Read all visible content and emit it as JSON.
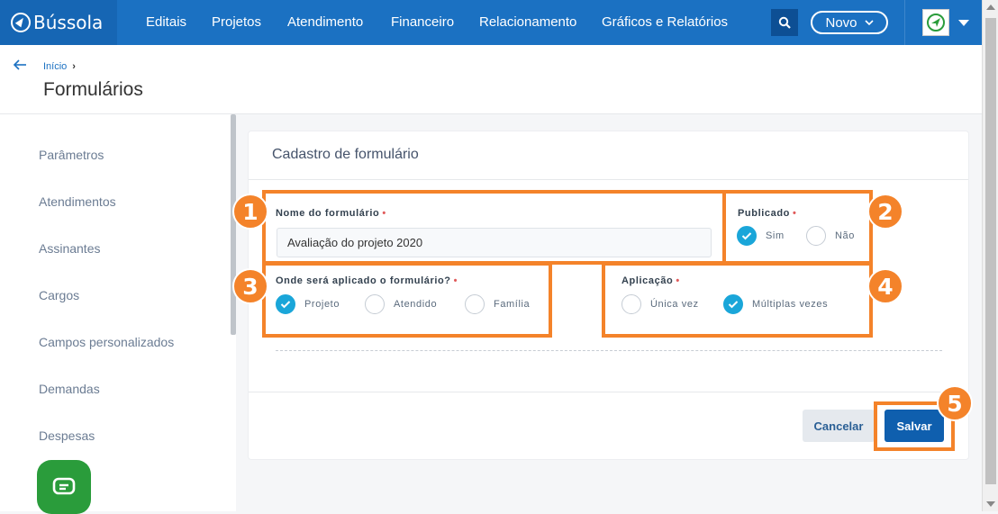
{
  "nav": {
    "brand": "Bússola",
    "items": [
      "Editais",
      "Projetos",
      "Atendimento",
      "Financeiro",
      "Relacionamento",
      "Gráficos e Relatórios"
    ],
    "novo_label": "Novo"
  },
  "header": {
    "breadcrumb": "Início",
    "title": "Formulários"
  },
  "sidebar": {
    "items": [
      "Parâmetros",
      "Atendimentos",
      "Assinantes",
      "Cargos",
      "Campos personalizados",
      "Demandas",
      "Despesas"
    ]
  },
  "form": {
    "card_title": "Cadastro de formulário",
    "name_label": "Nome do formulário",
    "name_value": "Avaliação do projeto 2020",
    "published_label": "Publicado",
    "published_options": [
      "Sim",
      "Não"
    ],
    "published_selected": "Sim",
    "apply_label": "Onde será aplicado o formulário?",
    "apply_options": [
      "Projeto",
      "Atendido",
      "Família"
    ],
    "apply_selected": [
      "Projeto"
    ],
    "application_label": "Aplicação",
    "application_options": [
      "Única vez",
      "Múltiplas vezes"
    ],
    "application_selected": "Múltiplas vezes",
    "required_mark": "•",
    "cancel_label": "Cancelar",
    "save_label": "Salvar"
  },
  "annotations": [
    "1",
    "2",
    "3",
    "4",
    "5"
  ],
  "colors": {
    "nav_bg": "#1b71c2",
    "accent": "#1aa6d9",
    "save_button": "#0f5fae",
    "annotation": "#f4832a",
    "chat": "#2a9c3b"
  },
  "icons": {
    "search": "search-icon",
    "chat": "chat-icon",
    "back": "back-arrow-icon",
    "check": "check-icon"
  }
}
